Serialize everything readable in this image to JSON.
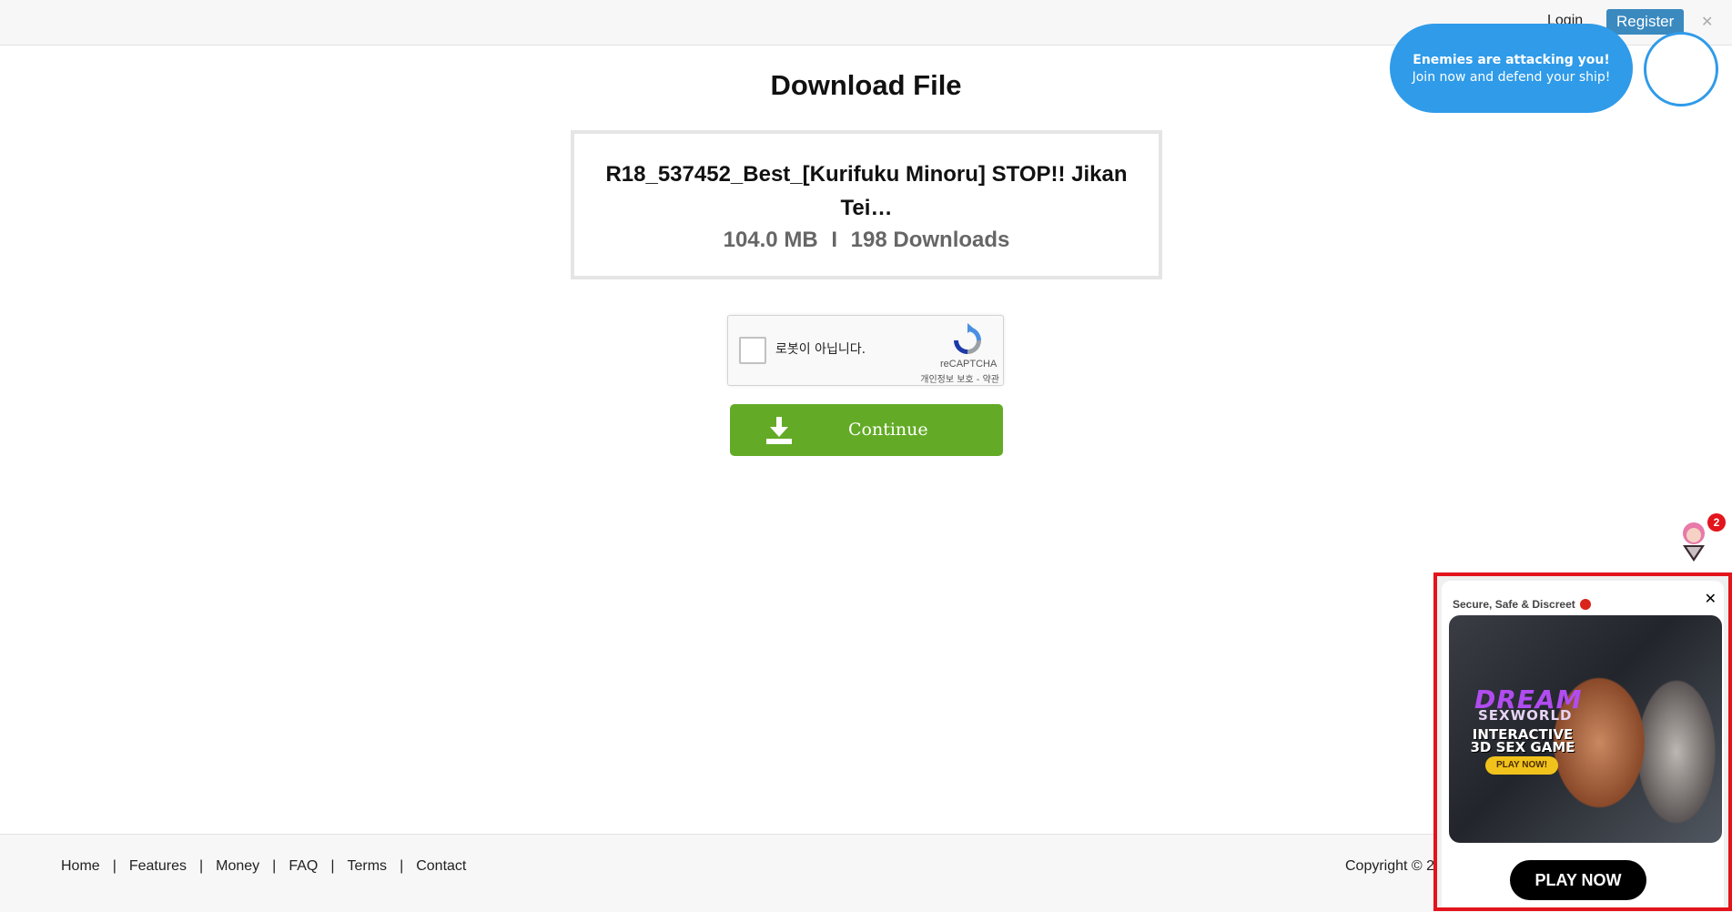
{
  "header": {
    "login_label": "Login",
    "register_label": "Register",
    "close_glyph": "✕"
  },
  "notification": {
    "line1": "Enemies are attacking you!",
    "line2": "Join now and defend your ship!"
  },
  "main": {
    "title": "Download File",
    "file_name": "R18_537452_Best_[Kurifuku Minoru] STOP!! Jikan Tei…",
    "file_size": "104.0 MB",
    "meta_separator": "I",
    "download_count": "198 Downloads"
  },
  "recaptcha": {
    "label": "로봇이 아닙니다.",
    "brand": "reCAPTCHA",
    "terms": "개인정보 보호 - 약관"
  },
  "continue_button": {
    "label": "Continue"
  },
  "side_widget": {
    "badge_count": "2"
  },
  "footer": {
    "links": [
      "Home",
      "Features",
      "Money",
      "FAQ",
      "Terms",
      "Contact"
    ],
    "separator": "|",
    "copyright": "Copyright © 2"
  },
  "ad": {
    "tagline": "Secure, Safe & Discreet",
    "close_glyph": "✕",
    "logo_line1": "DREAM",
    "logo_line2": "SEXWORLD",
    "headline": "INTERACTIVE 3D SEX GAME",
    "mini_button": "PLAY NOW!",
    "cta": "PLAY NOW"
  },
  "colors": {
    "register_bg": "#3a89bf",
    "notification_bg": "#2f9be9",
    "continue_bg": "#63ab26",
    "ad_border": "#e3141b",
    "badge_bg": "#e3141b"
  }
}
